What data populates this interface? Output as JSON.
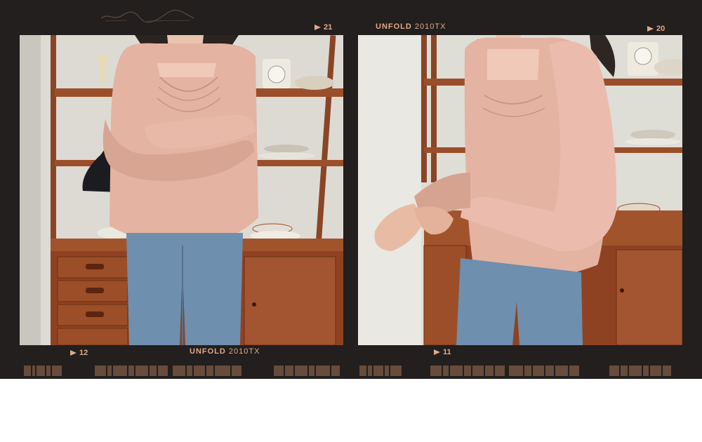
{
  "film": {
    "brand": "UNFOLD",
    "model": "2010TX",
    "frame_top_left": "21",
    "frame_top_right": "20",
    "frame_bottom_left": "12",
    "frame_bottom_right": "11"
  },
  "colors": {
    "film_base": "#221f1e",
    "film_text": "#e0a98a",
    "blouse": "#e4b3a2",
    "denim": "#6f8fae",
    "wood": "#9a4f2a"
  }
}
